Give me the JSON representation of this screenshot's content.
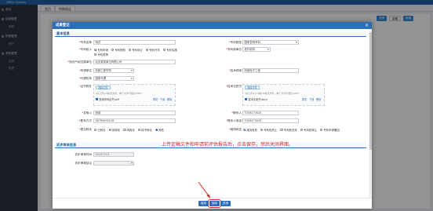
{
  "app": {
    "brand": "Office System",
    "tab_home": "首页",
    "tab_active": "特殊报告"
  },
  "sidebar": {
    "items": [
      {
        "label": "首页"
      },
      {
        "label": "经营管理"
      },
      {
        "label": "科研"
      },
      {
        "label": "报销管理"
      },
      {
        "label": "资产"
      },
      {
        "label": "考勤管理"
      },
      {
        "label": "合同"
      },
      {
        "label": "报表"
      }
    ]
  },
  "toolbar": {
    "buttons": [
      "查询",
      "重置",
      "新增"
    ]
  },
  "modal": {
    "title": "成果登记",
    "close": "×",
    "section_basic": "基本信息",
    "section_review": "初步审核信息",
    "fields": {
      "name_label": "专利名称",
      "name_value": "测试",
      "type_label": "专利类型",
      "type_value": "国家发明专利",
      "owner_label": "专利权人",
      "owner_options": [
        "专利申请",
        "专利授权",
        "专利转让",
        "专利许可",
        "专利实施"
      ],
      "owner_extra": "专利质押",
      "org_label": "专利权单位",
      "org_value": "校外机构",
      "unit_label": "知识产权归属单位",
      "unit_value": "北京某某单位有限公司",
      "apply_org_label": "申请单位",
      "apply_org_value": "机械工程学院",
      "tech_label": "技术领域",
      "tech_value": "机械电子工程",
      "agency_label": "代理机构",
      "agency_value": "国家代理",
      "cert_label": "证书附件",
      "cert_upload": "选择文件",
      "cert_hint": "(请上传pdf格式文件，单个文件不超过10M)",
      "cert_file": "发明专利证书.pdf",
      "cert_preview": "预览",
      "cert_download": "下载",
      "cert_delete": "删除",
      "doc_label": "技术交底书",
      "doc_upload": "选择文件",
      "doc_hint": "(请上传word或pdf格式文件，单个文件不超过10M)",
      "doc_file": "技术交底书.docx",
      "doc_preview": "预览",
      "doc_download": "下载",
      "doc_delete": "删除",
      "inventor_label": "发明人",
      "inventor_value": "张某",
      "contact_label": "联系人",
      "contact_value": "TG06173415",
      "phone_label": "联系方式",
      "phone_value": "18799492128",
      "contact_phone_label": "联系人电话",
      "contact_phone_value": "TG06173415",
      "transfer_label": "是否转化",
      "transfer_options": [
        "已转化",
        "拟转化",
        "未转化",
        "拟不转化",
        "其他"
      ],
      "status_label": "维持状态",
      "status_options": [
        "维持有效",
        "专利权终止",
        "专利权无效",
        "专利权转让",
        "专利申请撤回"
      ],
      "review_date_label": "初步审核时间",
      "review_date_value": "2019/7/16",
      "review_result_label": "初步审核结论"
    },
    "annotation": "上传定稿文件和申请前评估报告后，点击保存，然后关闭界面。",
    "footer": {
      "btn_save_draft": "保存",
      "btn_submit": "保存",
      "btn_close": "关闭"
    }
  },
  "colors": {
    "accent": "#2b6fb8",
    "annotation": "#e02424",
    "sidebar_bg": "#2b3443"
  }
}
